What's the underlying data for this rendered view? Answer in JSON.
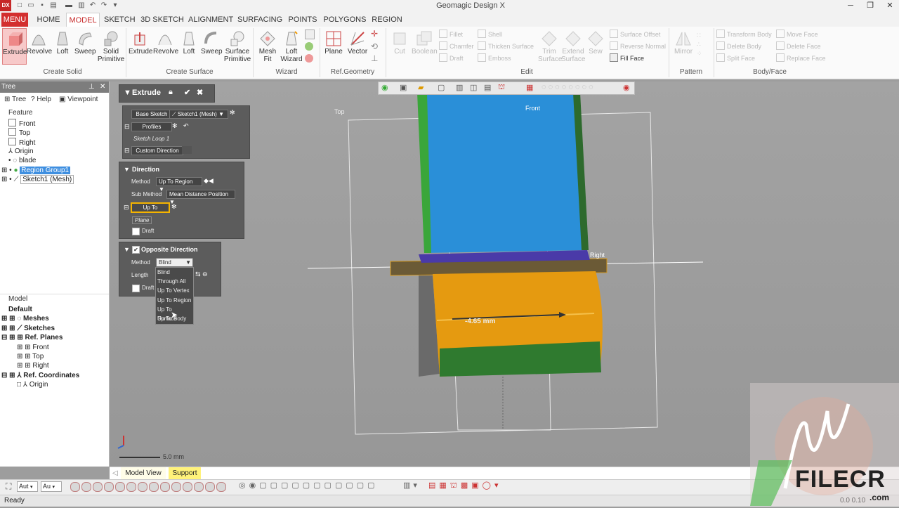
{
  "window": {
    "title": "Geomagic Design X",
    "app_icon": "DX"
  },
  "tabs": [
    "HOME",
    "MODEL",
    "SKETCH",
    "3D SKETCH",
    "ALIGNMENT",
    "SURFACING",
    "POINTS",
    "POLYGONS",
    "REGION"
  ],
  "menu_label": "MENU",
  "ribbon": {
    "create_solid": {
      "label": "Create Solid",
      "buttons": [
        "Extrude",
        "Revolve",
        "Loft",
        "Sweep",
        "Solid Primitive"
      ]
    },
    "create_surface": {
      "label": "Create Surface",
      "buttons": [
        "Extrude",
        "Revolve",
        "Loft",
        "Sweep",
        "Surface Primitive"
      ]
    },
    "wizard": {
      "label": "Wizard",
      "buttons": [
        "Mesh Fit",
        "Loft Wizard"
      ]
    },
    "ref_geometry": {
      "label": "Ref.Geometry",
      "buttons": [
        "Plane",
        "Vector"
      ]
    },
    "edit": {
      "label": "Edit",
      "big": [
        "Cut",
        "Boolean",
        "Trim Surface",
        "Extend Surface",
        "Sew"
      ],
      "small": [
        "Fillet",
        "Chamfer",
        "Draft",
        "Shell",
        "Thicken Surface",
        "Emboss",
        "Surface Offset",
        "Reverse Normal",
        "Fill Face"
      ]
    },
    "pattern": {
      "label": "Pattern",
      "buttons": [
        "Mirror"
      ]
    },
    "body_face": {
      "label": "Body/Face",
      "small": [
        "Transform Body",
        "Delete Body",
        "Split Face",
        "Move Face",
        "Delete Face",
        "Replace Face"
      ]
    }
  },
  "tree": {
    "header": "Tree",
    "tabs": [
      "Tree",
      "Help",
      "Viewpoint"
    ],
    "feature_label": "Feature",
    "items": [
      "Front",
      "Top",
      "Right",
      "Origin",
      "blade",
      "Region Group1",
      "Sketch1 (Mesh)"
    ],
    "model_label": "Model",
    "model_items": [
      "Default",
      "Meshes",
      "Sketches",
      "Ref. Planes",
      "Front",
      "Top",
      "Right",
      "Ref. Coordinates",
      "Origin"
    ]
  },
  "extrude": {
    "title": "Extrude",
    "base_sketch_label": "Base Sketch",
    "base_sketch_value": "Sketch1 (Mesh)",
    "profiles_label": "Profiles",
    "profile_item": "Sketch Loop 1",
    "custom_direction_label": "Custom Direction",
    "direction_title": "Direction",
    "method_label": "Method",
    "method_value": "Up To Region",
    "sub_method_label": "Sub Method",
    "sub_method_value": "Mean Distance Position",
    "up_to_label": "Up To",
    "up_to_item": "Plane",
    "draft_label": "Draft",
    "opposite_title": "Opposite Direction",
    "opp_method_label": "Method",
    "opp_method_value": "Blind",
    "length_label": "Length",
    "opp_draft_label": "Draft",
    "dropdown_options": [
      "Blind",
      "Through All",
      "Up To Vertex",
      "Up To Region",
      "Up To Surface",
      "Up To Body"
    ]
  },
  "viewport": {
    "plane_labels": [
      "Top",
      "Front",
      "Right"
    ],
    "dimension": "-4.65 mm",
    "scale": "5.0 mm"
  },
  "view_tabs": [
    "Model View",
    "Support"
  ],
  "toolbar": {
    "select1": "Aut",
    "select2": "Au"
  },
  "status": {
    "text": "Ready",
    "coords": "0.0 0.10"
  },
  "watermark": {
    "brand": "FILECR",
    ".com": ".com"
  },
  "colors": {
    "accent": "#d32f2f",
    "selection": "#3f8fe0",
    "panel": "#5c5c5c",
    "highlight": "#f5b400"
  }
}
